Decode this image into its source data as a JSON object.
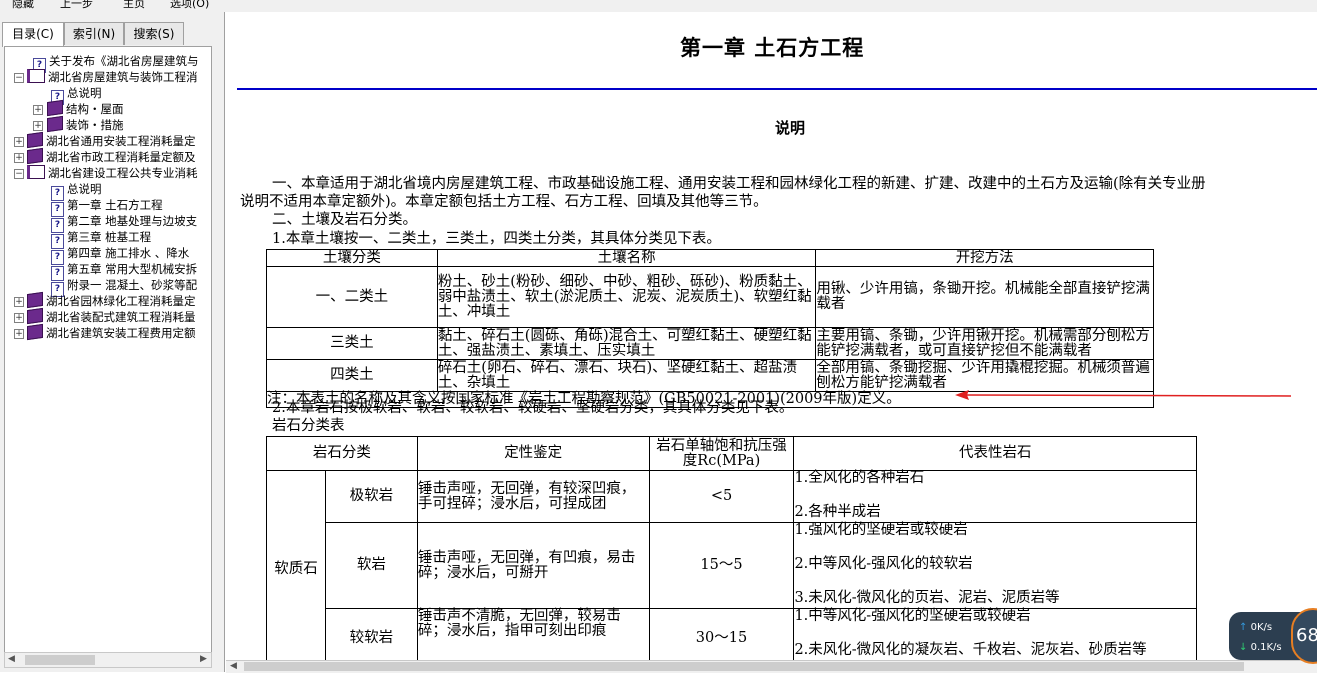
{
  "toolbar": {
    "hide": "隐藏",
    "back": "上一步",
    "home": "主页",
    "options": "选项(O)"
  },
  "tabs": [
    {
      "label": "目录(C)"
    },
    {
      "label": "索引(N)"
    },
    {
      "label": "搜索(S)"
    }
  ],
  "tree": [
    {
      "label": "关于发布《湖北省房屋建筑与"
    },
    {
      "label": "湖北省房屋建筑与装饰工程消"
    },
    {
      "label": "总说明"
    },
    {
      "label": "结构・屋面"
    },
    {
      "label": "装饰・措施"
    },
    {
      "label": "湖北省通用安装工程消耗量定"
    },
    {
      "label": "湖北省市政工程消耗量定额及"
    },
    {
      "label": "湖北省建设工程公共专业消耗"
    },
    {
      "label": "总说明"
    },
    {
      "label": "第一章  土石方工程"
    },
    {
      "label": "第二章  地基处理与边坡支"
    },
    {
      "label": "第三章  桩基工程"
    },
    {
      "label": "第四章  施工排水 、降水"
    },
    {
      "label": "第五章  常用大型机械安拆"
    },
    {
      "label": "附录一  混凝土、砂浆等配"
    },
    {
      "label": "湖北省园林绿化工程消耗量定"
    },
    {
      "label": "湖北省装配式建筑工程消耗量"
    },
    {
      "label": "湖北省建筑安装工程费用定额"
    }
  ],
  "doc": {
    "chapter_title": "第一章  土石方工程",
    "section_title": "说明",
    "para1_line1": "一、本章适用于湖北省境内房屋建筑工程、市政基础设施工程、通用安装工程和园林绿化工程的新建、扩建、改建中的土石方及运输(除有关专业册",
    "para1_line2": "说明不适用本章定额外)。本章定额包括土方工程、石方工程、回填及其他等三节。",
    "para2": "二、土壤及岩石分类。",
    "para3": "1.本章土壤按一、二类土，三类土，四类土分类，其具体分类见下表。",
    "soil_table": {
      "headers": [
        "土壤分类",
        "土壤名称",
        "开挖方法"
      ],
      "rows": [
        {
          "class": "一、二类土",
          "name": "粉土、砂土(粉砂、细砂、中砂、粗砂、砾砂)、粉质黏土、弱中盐渍土、软土(淤泥质土、泥炭、泥炭质土)、软塑红黏土、冲填土",
          "method": "用锹、少许用镐，条锄开挖。机械能全部直接铲挖满载者"
        },
        {
          "class": "三类土",
          "name": "黏土、碎石土(圆砾、角砾)混合土、可塑红黏土、硬塑红黏土、强盐渍土、素填土、压实填土",
          "method": "主要用镐、条锄，少许用锹开挖。机械需部分刨松方能铲挖满载者，或可直接铲挖但不能满载者"
        },
        {
          "class": "四类土",
          "name": "碎石土(卵石、碎石、漂石、块石)、坚硬红黏土、超盐渍土、杂填土",
          "method": "全部用镐、条锄挖掘、少许用撬棍挖掘。机械须普遍刨松方能铲挖满载者"
        }
      ],
      "note": "注：本表土的名称及其含义按国家标准《岩土工程勘察规范》(GB50021-2001)(2009年版)定义。"
    },
    "para4": "2.本章岩石按极软岩、软岩、较软岩、较硬岩、坚硬岩分类，其具体分类见下表。",
    "rock_table_title": "岩石分类表",
    "rock_table": {
      "headers": [
        "岩石分类",
        "定性鉴定",
        "岩石单轴饱和抗压强度Rc(MPa)",
        "代表性岩石"
      ],
      "group": "软质石",
      "rows": [
        {
          "sub": "极软岩",
          "desc": "锤击声哑，无回弹，有较深凹痕，手可捏碎；浸水后，可捏成团",
          "rc": "<5",
          "rep1": "1.全风化的各种岩石",
          "rep2": "2.各种半成岩",
          "rep3": ""
        },
        {
          "sub": "软岩",
          "desc": "锤击声哑，无回弹，有凹痕，易击碎；浸水后，可掰开",
          "rc": "15～5",
          "rep1": "1.强风化的坚硬岩或较硬岩",
          "rep2": "2.中等风化-强风化的较软岩",
          "rep3": "3.未风化-微风化的页岩、泥岩、泥质岩等"
        },
        {
          "sub": "较软岩",
          "desc": "锤击声不清脆，无回弹，较易击碎；浸水后，指甲可刻出印痕",
          "rc": "30～15",
          "rep1": "1.中等风化-强风化的坚硬岩或较硬岩",
          "rep2": "2.未风化-微风化的凝灰岩、千枚岩、泥灰岩、砂质岩等",
          "rep3": ""
        }
      ]
    }
  },
  "speed_widget": {
    "up": "0K/s",
    "down": "0.1K/s",
    "percent": "68"
  },
  "colors": {
    "rule": "#0000c8",
    "annotation_arrow": "#e02020"
  }
}
